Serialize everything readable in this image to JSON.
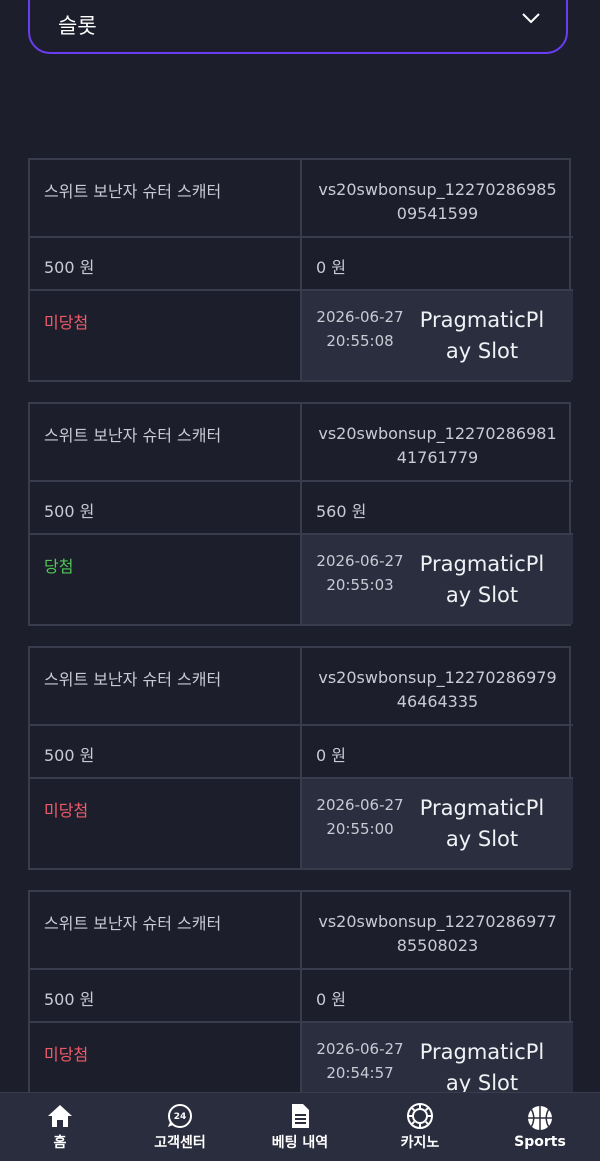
{
  "filter": {
    "selected": "슬롯"
  },
  "records": [
    {
      "game_name": "스위트 보난자 슈터 스캐터",
      "game_id": "vs20swbonsup_1227028698509541599",
      "bet": "500 원",
      "win": "0 원",
      "status": "미당첨",
      "status_type": "lose",
      "date": "2026-06-27",
      "time": "20:55:08",
      "provider": "PragmaticPlay Slot"
    },
    {
      "game_name": "스위트 보난자 슈터 스캐터",
      "game_id": "vs20swbonsup_1227028698141761779",
      "bet": "500 원",
      "win": "560 원",
      "status": "당첨",
      "status_type": "win",
      "date": "2026-06-27",
      "time": "20:55:03",
      "provider": "PragmaticPlay Slot"
    },
    {
      "game_name": "스위트 보난자 슈터 스캐터",
      "game_id": "vs20swbonsup_1227028697946464335",
      "bet": "500 원",
      "win": "0 원",
      "status": "미당첨",
      "status_type": "lose",
      "date": "2026-06-27",
      "time": "20:55:00",
      "provider": "PragmaticPlay Slot"
    },
    {
      "game_name": "스위트 보난자 슈터 스캐터",
      "game_id": "vs20swbonsup_1227028697785508023",
      "bet": "500 원",
      "win": "0 원",
      "status": "미당첨",
      "status_type": "lose",
      "date": "2026-06-27",
      "time": "20:54:57",
      "provider": "PragmaticPlay Slot"
    }
  ],
  "bottom_nav": [
    {
      "label": "홈",
      "icon": "home-icon"
    },
    {
      "label": "고객센터",
      "icon": "support-24-icon"
    },
    {
      "label": "베팅 내역",
      "icon": "document-icon"
    },
    {
      "label": "카지노",
      "icon": "casino-chip-icon"
    },
    {
      "label": "Sports",
      "icon": "basketball-icon"
    }
  ],
  "colors": {
    "background": "#1c1e2b",
    "dropdown_border": "#6a3df2",
    "cell_border": "#393c4c",
    "meta_background": "#2b2e3e",
    "lose": "#ef5b6a",
    "win": "#51c657",
    "nav_background": "#2a2d3d"
  }
}
